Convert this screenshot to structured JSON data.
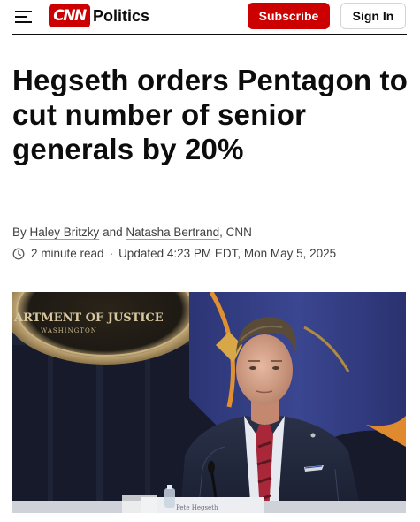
{
  "header": {
    "menu_icon": "hamburger-menu-icon",
    "logo_text": "CNN",
    "section": "Politics",
    "subscribe_label": "Subscribe",
    "signin_label": "Sign In",
    "brand_color": "#cc0000"
  },
  "article": {
    "headline": "Hegseth orders Pentagon to cut number of senior generals by 20%",
    "byline": {
      "prefix": "By",
      "author1": "Haley Britzky",
      "conjunction": "and",
      "author2": "Natasha Bertrand",
      "outlet": ", CNN"
    },
    "meta": {
      "clock_icon": "clock-icon",
      "read_time": "2 minute read",
      "separator": "·",
      "updated": "Updated 4:23 PM EDT, Mon May 5, 2025"
    },
    "image": {
      "seal_text": "ARTMENT OF JUSTICE",
      "seal_subtext": "WASHINGTON",
      "nameplate": "Pete Hegseth"
    }
  }
}
